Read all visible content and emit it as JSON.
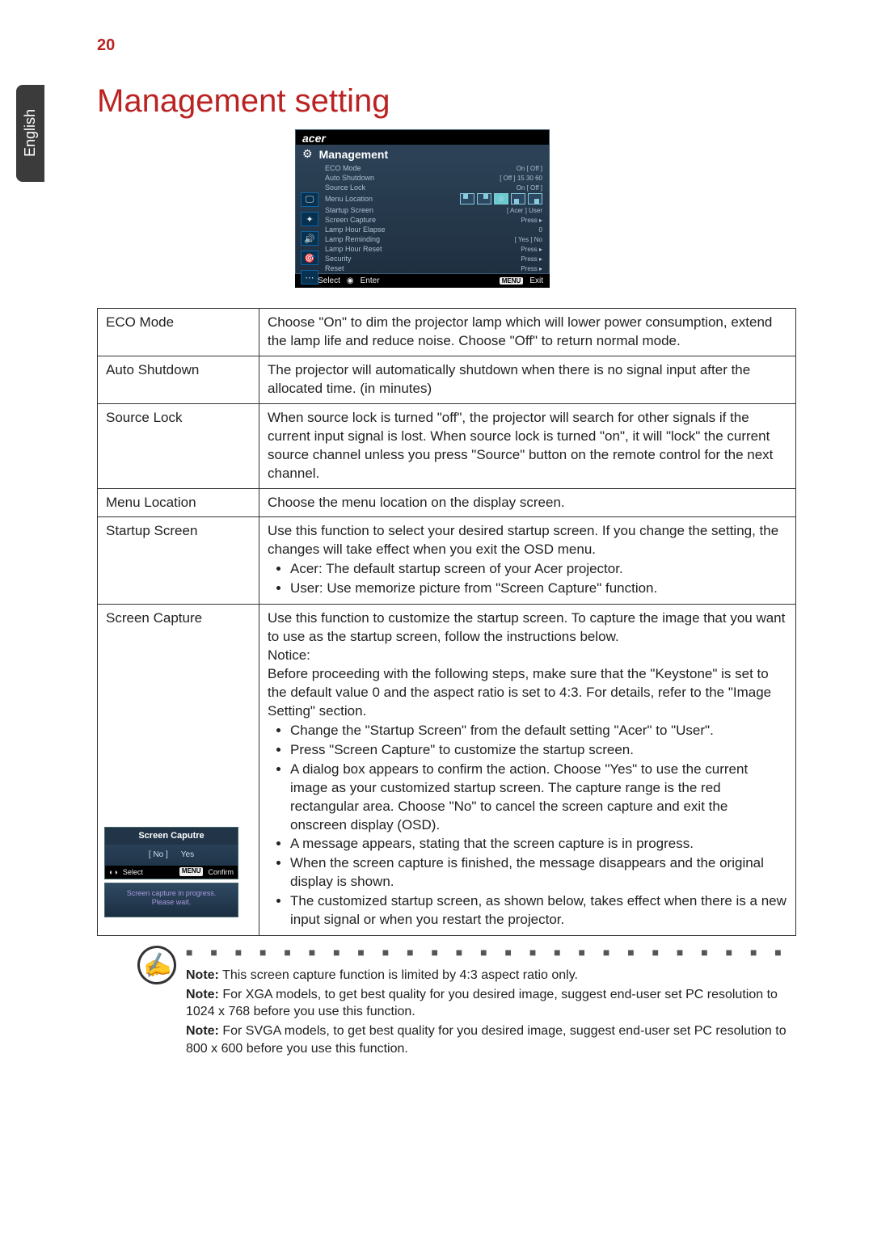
{
  "page_number": "20",
  "side_tab": "English",
  "heading": "Management setting",
  "osd": {
    "logo": "acer",
    "title": "Management",
    "rows": {
      "eco_mode": {
        "label": "ECO Mode",
        "vals": "On    [    Off    ]"
      },
      "auto_shutdown": {
        "label": "Auto Shutdown",
        "vals": "[    Off    ]   15   30   60"
      },
      "source_lock": {
        "label": "Source Lock",
        "vals": "On    [    Off    ]"
      },
      "menu_location": {
        "label": "Menu Location"
      },
      "startup_screen": {
        "label": "Startup Screen",
        "vals": "[   Acer   ]   User"
      },
      "screen_capture": {
        "label": "Screen Capture",
        "vals": "Press   ▸"
      },
      "lamp_elapse": {
        "label": "Lamp Hour Elapse",
        "vals": "0"
      },
      "lamp_remind": {
        "label": "Lamp Reminding",
        "vals": "[   Yes   ]   No"
      },
      "lamp_reset": {
        "label": "Lamp Hour Reset",
        "vals": "Press   ▸"
      },
      "security": {
        "label": "Security",
        "vals": "Press   ▸"
      },
      "reset": {
        "label": "Reset",
        "vals": "Press   ▸"
      }
    },
    "foot": {
      "select": "Select",
      "enter": "Enter",
      "menu": "MENU",
      "exit": "Exit"
    },
    "nav_glyphs": "◐◑",
    "enter_glyph": "◉",
    "side_icons": [
      "🖵",
      "✦",
      "🔊",
      "🎯",
      "⋯"
    ]
  },
  "table": {
    "eco_mode": {
      "k": "ECO Mode",
      "v": "Choose \"On\" to dim the projector lamp which will lower power consumption, extend the lamp life and reduce noise.  Choose \"Off\" to return normal mode."
    },
    "auto_shutdown": {
      "k": "Auto Shutdown",
      "v": "The projector will automatically shutdown when there is no signal input after the allocated time. (in minutes)"
    },
    "source_lock": {
      "k": "Source Lock",
      "v": "When source lock is turned \"off\", the projector will search for other signals if the current input signal is lost. When source lock is turned \"on\", it will \"lock\" the current source channel unless you press \"Source\" button on the remote control for the next channel."
    },
    "menu_location": {
      "k": "Menu Location",
      "v": "Choose the menu location on the display screen."
    },
    "startup": {
      "k": "Startup Screen",
      "intro": "Use this function to select your desired startup screen. If you change the setting, the changes will take effect when you exit the OSD menu.",
      "b1": "Acer: The default startup screen of your Acer projector.",
      "b2": "User: Use memorize picture from \"Screen Capture\" function."
    },
    "capture": {
      "k": "Screen Capture",
      "p1": "Use this function to customize the startup screen. To capture the image that you want to use as the startup screen, follow the instructions below.",
      "p2": "Notice:",
      "p3": "Before proceeding with the following steps, make sure that the \"Keystone\" is set to the default value 0 and the aspect ratio is set to 4:3. For details, refer to the \"Image Setting\" section.",
      "b1": "Change the \"Startup Screen\" from the default setting \"Acer\" to \"User\".",
      "b2": "Press \"Screen Capture\" to customize the startup screen.",
      "b3": "A dialog box appears to confirm the action. Choose \"Yes\" to use the current image as your customized startup screen. The capture range is the red rectangular area. Choose \"No\" to cancel the screen capture and exit the onscreen display (OSD).",
      "b4": "A message appears, stating that the screen capture is in progress.",
      "b5": "When the screen capture is finished, the message disappears and the original display is shown.",
      "b6": "The customized startup screen, as shown below, takes effect when there is a new input signal or when you restart the projector."
    }
  },
  "sc_box": {
    "title": "Screen Caputre",
    "no": "No",
    "yes": "Yes",
    "select": "Select",
    "confirm": "Confirm",
    "menu": "MENU",
    "msg1": "Screen capture in progress.",
    "msg2": "Please wait."
  },
  "notes": {
    "n1a": "Note:",
    "n1b": " This screen capture function is limited by 4:3 aspect ratio only.",
    "n2a": "Note:",
    "n2b": " For XGA models, to get best quality for you desired image, suggest end-user set PC resolution to 1024 x 768 before you use this function.",
    "n3a": "Note:",
    "n3b": " For SVGA models, to get best quality for you desired image, suggest end-user set PC resolution to 800 x 600 before you use this function."
  },
  "note_icon": "✍"
}
